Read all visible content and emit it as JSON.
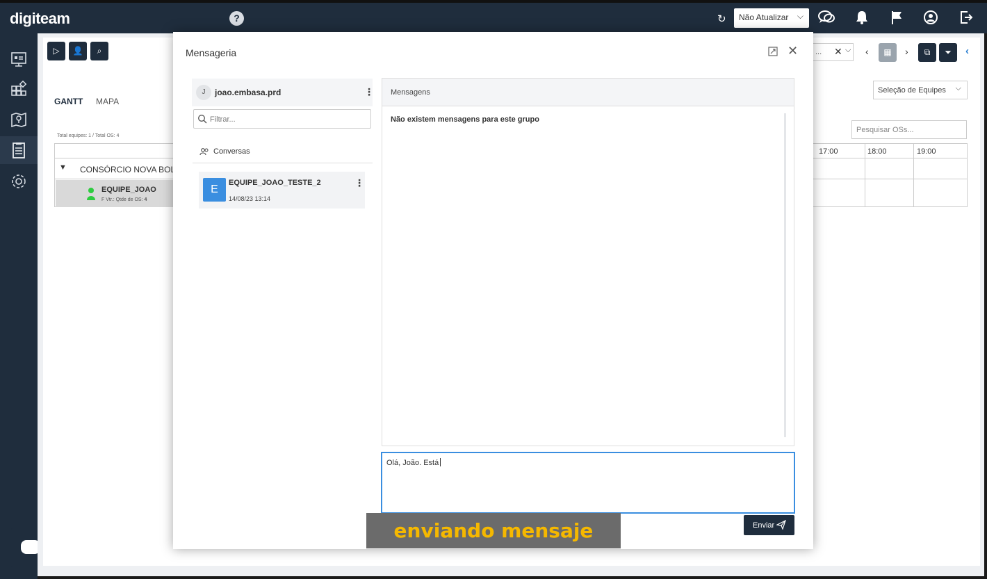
{
  "app": {
    "logo": "digiteam",
    "help_glyph": "?"
  },
  "topbar": {
    "update_select": "Não Atualizar",
    "icons": [
      "refresh-icon",
      "chat-icon",
      "bell-icon",
      "flag-icon",
      "user-circle-icon",
      "logout-icon"
    ]
  },
  "sidebar": {
    "items": [
      "dashboard-icon",
      "modules-icon",
      "map-icon",
      "clipboard-icon",
      "settings-icon"
    ],
    "active": "clipboard-icon"
  },
  "page": {
    "tabs": [
      {
        "label": "GANTT",
        "active": true
      },
      {
        "label": "MAPA",
        "active": false
      }
    ],
    "totals": "Total equipes: 1 / Total OS: 4",
    "group": "CONSÓRCIO NOVA BOLAN",
    "team": {
      "name": "EQUIPE_JOAO",
      "sub_label": "F Vtr.: Qtde de OS:",
      "count": "4"
    },
    "hours": [
      "17:00",
      "18:00",
      "19:00"
    ],
    "team_select": "Seleção de Equipes",
    "search_os_placeholder": "Pesquisar OSs...",
    "bg_select": "..."
  },
  "modal": {
    "title": "Mensageria",
    "user": {
      "initial": "J",
      "name": "joao.embasa.prd"
    },
    "filter_placeholder": "Filtrar...",
    "conversations_label": "Conversas",
    "conversations": [
      {
        "initial": "E",
        "name": "EQUIPE_JOAO_TESTE_2",
        "date": "14/08/23 13:14"
      }
    ],
    "messages_header": "Mensagens",
    "empty_text": "Não existem mensagens para este grupo",
    "compose_value": "Olá, João. Está",
    "send_label": "Enviar"
  },
  "caption": "enviando mensaje",
  "colors": {
    "navy": "#1f2d3d",
    "accent_blue": "#3a8ee0",
    "caption_text": "#f5b800",
    "caption_bg": "#6b6b6b"
  }
}
